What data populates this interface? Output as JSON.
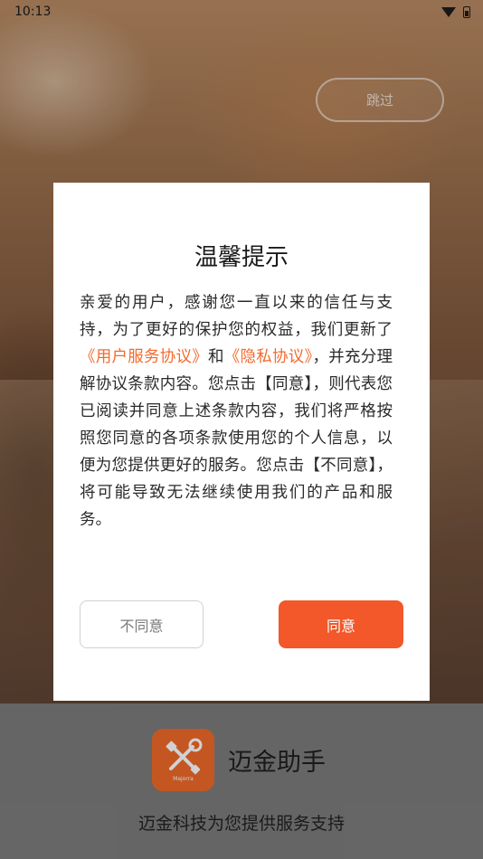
{
  "status_bar": {
    "time": "10:13"
  },
  "skip_label": "跳过",
  "dialog": {
    "title": "温馨提示",
    "body_part1": "亲爱的用户，感谢您一直以来的信任与支持，为了更好的保护您的权益，我们更新了",
    "link_user_agreement": "《用户服务协议》",
    "body_part2": "和",
    "link_privacy_policy": "《隐私协议》",
    "body_part3": "，并充分理解协议条款内容。您点击【同意】，则代表您已阅读并同意上述条款内容，我们将严格按照您同意的各项条款使用您的个人信息，以便为您提供更好的服务。您点击【不同意】，将可能导致无法继续使用我们的产品和服务。",
    "decline_label": "不同意",
    "agree_label": "同意"
  },
  "app": {
    "icon": "tools-icon",
    "icon_caption": "Majorra",
    "name": "迈金助手",
    "slogan": "迈金科技为您提供服务支持"
  },
  "colors": {
    "accent": "#f2582a",
    "link": "#f26a2e",
    "bottom_panel": "#7c7c7c"
  }
}
